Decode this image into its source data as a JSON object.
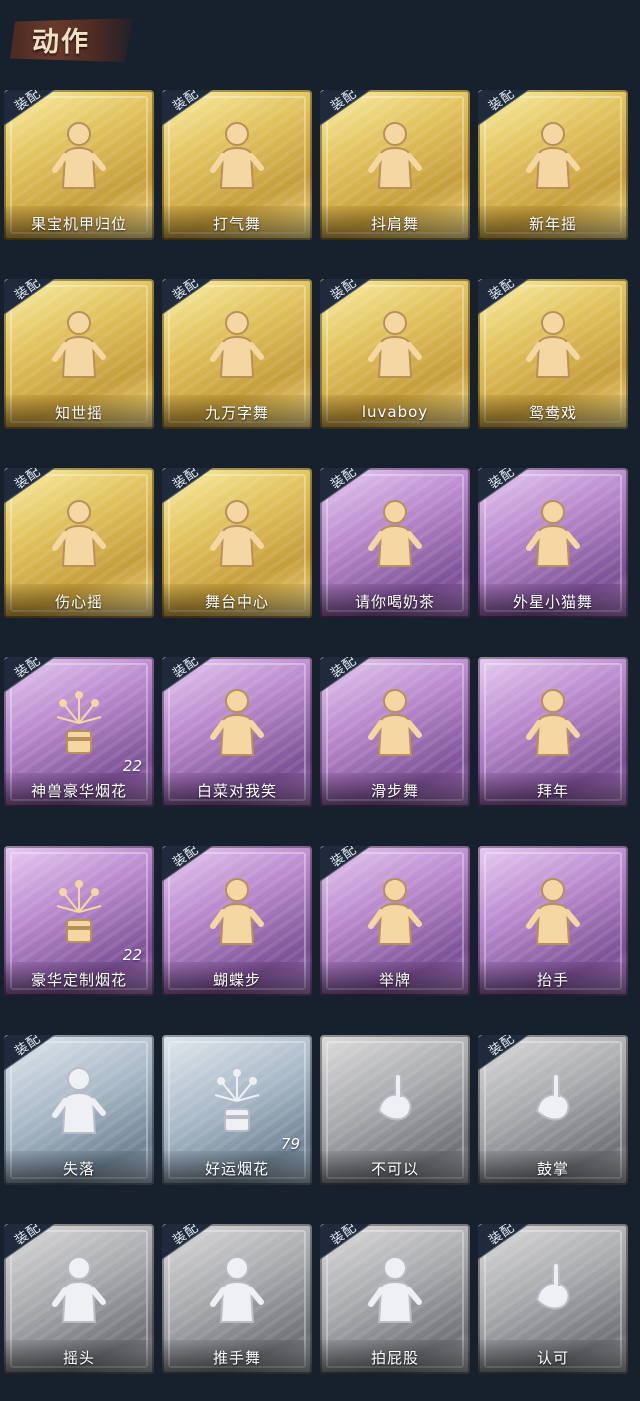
{
  "header": {
    "title": "动作"
  },
  "equip_label": "装配",
  "colors": {
    "gold": "#d7b64c",
    "purple": "#a878bd",
    "blue": "#97a9b8",
    "gray": "#9fa1a5",
    "background": "#17202d"
  },
  "cards": [
    {
      "name": "果宝机甲归位",
      "rarity": "gold",
      "equipped": true,
      "icon": "figure-pose-icon"
    },
    {
      "name": "打气舞",
      "rarity": "gold",
      "equipped": true,
      "icon": "figure-dance-icon"
    },
    {
      "name": "抖肩舞",
      "rarity": "gold",
      "equipped": true,
      "icon": "figure-shoulder-icon"
    },
    {
      "name": "新年摇",
      "rarity": "gold",
      "equipped": true,
      "icon": "figure-shake-icon"
    },
    {
      "name": "知世摇",
      "rarity": "gold",
      "equipped": true,
      "icon": "figure-sway-icon"
    },
    {
      "name": "九万字舞",
      "rarity": "gold",
      "equipped": true,
      "icon": "figure-swirl-icon"
    },
    {
      "name": "luvaboy",
      "rarity": "gold",
      "equipped": true,
      "icon": "figure-arm-icon"
    },
    {
      "name": "鸳鸯戏",
      "rarity": "gold",
      "equipped": true,
      "icon": "figure-wave-icon"
    },
    {
      "name": "伤心摇",
      "rarity": "gold",
      "equipped": true,
      "icon": "figure-heart-icon"
    },
    {
      "name": "舞台中心",
      "rarity": "gold",
      "equipped": true,
      "icon": "figure-sparkle-icon"
    },
    {
      "name": "请你喝奶茶",
      "rarity": "purple",
      "equipped": true,
      "icon": "figure-sign-icon"
    },
    {
      "name": "外星小猫舞",
      "rarity": "purple",
      "equipped": true,
      "icon": "figure-cross-arms-icon"
    },
    {
      "name": "神兽豪华烟花",
      "rarity": "purple",
      "equipped": true,
      "icon": "fireworks-icon",
      "count": "22"
    },
    {
      "name": "白菜对我笑",
      "rarity": "purple",
      "equipped": true,
      "icon": "figure-cross-arms-icon"
    },
    {
      "name": "滑步舞",
      "rarity": "purple",
      "equipped": true,
      "icon": "figure-slide-icon"
    },
    {
      "name": "拜年",
      "rarity": "purple",
      "equipped": false,
      "icon": "figure-bow-icon"
    },
    {
      "name": "豪华定制烟花",
      "rarity": "purple",
      "equipped": false,
      "icon": "fireworks-box-icon",
      "count": "22"
    },
    {
      "name": "蝴蝶步",
      "rarity": "purple",
      "equipped": true,
      "icon": "figure-point-icon"
    },
    {
      "name": "举牌",
      "rarity": "purple",
      "equipped": true,
      "icon": "figure-sign-icon"
    },
    {
      "name": "抬手",
      "rarity": "purple",
      "equipped": false,
      "icon": "figure-raise-hand-icon"
    },
    {
      "name": "失落",
      "rarity": "blue",
      "equipped": true,
      "icon": "figure-crawl-icon"
    },
    {
      "name": "好运烟花",
      "rarity": "blue",
      "equipped": false,
      "icon": "firework-can-icon",
      "count": "79"
    },
    {
      "name": "不可以",
      "rarity": "gray",
      "equipped": false,
      "icon": "finger-wag-icon"
    },
    {
      "name": "鼓掌",
      "rarity": "gray",
      "equipped": true,
      "icon": "clap-hands-icon"
    },
    {
      "name": "摇头",
      "rarity": "gray",
      "equipped": true,
      "icon": "figure-shake-head-icon"
    },
    {
      "name": "推手舞",
      "rarity": "gray",
      "equipped": true,
      "icon": "figure-push-icon"
    },
    {
      "name": "拍屁股",
      "rarity": "gray",
      "equipped": true,
      "icon": "figure-pat-icon"
    },
    {
      "name": "认可",
      "rarity": "gray",
      "equipped": true,
      "icon": "thumbs-up-icon"
    }
  ]
}
